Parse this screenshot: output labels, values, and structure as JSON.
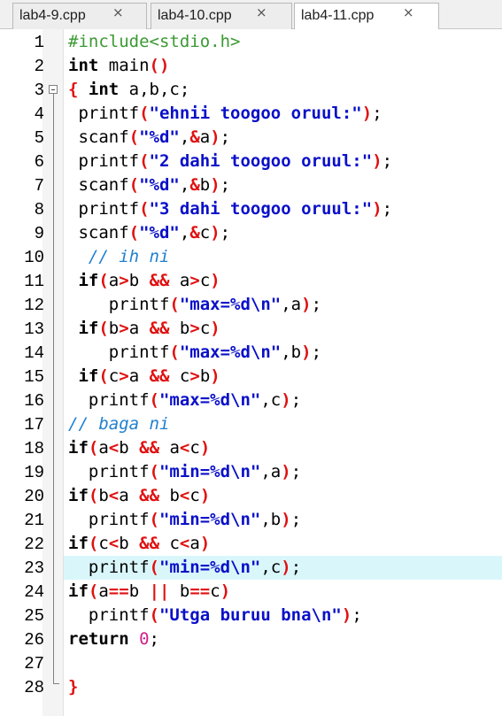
{
  "tabs": [
    {
      "label": "lab4-9.cpp",
      "close": "×",
      "active": false
    },
    {
      "label": "lab4-10.cpp",
      "close": "×",
      "active": false
    },
    {
      "label": "lab4-11.cpp",
      "close": "×",
      "active": true
    }
  ],
  "editor": {
    "highlighted_line": 23,
    "lines": [
      {
        "n": "1",
        "tokens": [
          [
            "pre",
            "#include<stdio.h>"
          ]
        ]
      },
      {
        "n": "2",
        "tokens": [
          [
            "kw",
            "int"
          ],
          [
            "pl",
            " main"
          ],
          [
            "op",
            "()"
          ]
        ]
      },
      {
        "n": "3",
        "tokens": [
          [
            "op",
            "{"
          ],
          [
            "pl",
            " "
          ],
          [
            "kw",
            "int"
          ],
          [
            "pl",
            " a,b,c;"
          ]
        ]
      },
      {
        "n": "4",
        "tokens": [
          [
            "pl",
            " printf"
          ],
          [
            "op",
            "("
          ],
          [
            "str",
            "\"ehnii toogoo oruul:\""
          ],
          [
            "op",
            ")"
          ],
          [
            "pl",
            ";"
          ]
        ]
      },
      {
        "n": "5",
        "tokens": [
          [
            "pl",
            " scanf"
          ],
          [
            "op",
            "("
          ],
          [
            "str",
            "\"%d\""
          ],
          [
            "pl",
            ","
          ],
          [
            "op",
            "&"
          ],
          [
            "pl",
            "a"
          ],
          [
            "op",
            ")"
          ],
          [
            "pl",
            ";"
          ]
        ]
      },
      {
        "n": "6",
        "tokens": [
          [
            "pl",
            " printf"
          ],
          [
            "op",
            "("
          ],
          [
            "str",
            "\"2 dahi toogoo oruul:\""
          ],
          [
            "op",
            ")"
          ],
          [
            "pl",
            ";"
          ]
        ]
      },
      {
        "n": "7",
        "tokens": [
          [
            "pl",
            " scanf"
          ],
          [
            "op",
            "("
          ],
          [
            "str",
            "\"%d\""
          ],
          [
            "pl",
            ","
          ],
          [
            "op",
            "&"
          ],
          [
            "pl",
            "b"
          ],
          [
            "op",
            ")"
          ],
          [
            "pl",
            ";"
          ]
        ]
      },
      {
        "n": "8",
        "tokens": [
          [
            "pl",
            " printf"
          ],
          [
            "op",
            "("
          ],
          [
            "str",
            "\"3 dahi toogoo oruul:\""
          ],
          [
            "op",
            ")"
          ],
          [
            "pl",
            ";"
          ]
        ]
      },
      {
        "n": "9",
        "tokens": [
          [
            "pl",
            " scanf"
          ],
          [
            "op",
            "("
          ],
          [
            "str",
            "\"%d\""
          ],
          [
            "pl",
            ","
          ],
          [
            "op",
            "&"
          ],
          [
            "pl",
            "c"
          ],
          [
            "op",
            ")"
          ],
          [
            "pl",
            ";"
          ]
        ]
      },
      {
        "n": "10",
        "tokens": [
          [
            "pl",
            "  "
          ],
          [
            "cm",
            "// ih ni"
          ]
        ]
      },
      {
        "n": "11",
        "tokens": [
          [
            "pl",
            " "
          ],
          [
            "kw",
            "if"
          ],
          [
            "op",
            "("
          ],
          [
            "pl",
            "a"
          ],
          [
            "op",
            ">"
          ],
          [
            "pl",
            "b "
          ],
          [
            "op",
            "&&"
          ],
          [
            "pl",
            " a"
          ],
          [
            "op",
            ">"
          ],
          [
            "pl",
            "c"
          ],
          [
            "op",
            ")"
          ]
        ]
      },
      {
        "n": "12",
        "tokens": [
          [
            "pl",
            "    printf"
          ],
          [
            "op",
            "("
          ],
          [
            "str",
            "\"max=%d\\n\""
          ],
          [
            "pl",
            ",a"
          ],
          [
            "op",
            ")"
          ],
          [
            "pl",
            ";"
          ]
        ]
      },
      {
        "n": "13",
        "tokens": [
          [
            "pl",
            " "
          ],
          [
            "kw",
            "if"
          ],
          [
            "op",
            "("
          ],
          [
            "pl",
            "b"
          ],
          [
            "op",
            ">"
          ],
          [
            "pl",
            "a "
          ],
          [
            "op",
            "&&"
          ],
          [
            "pl",
            " b"
          ],
          [
            "op",
            ">"
          ],
          [
            "pl",
            "c"
          ],
          [
            "op",
            ")"
          ]
        ]
      },
      {
        "n": "14",
        "tokens": [
          [
            "pl",
            "    printf"
          ],
          [
            "op",
            "("
          ],
          [
            "str",
            "\"max=%d\\n\""
          ],
          [
            "pl",
            ",b"
          ],
          [
            "op",
            ")"
          ],
          [
            "pl",
            ";"
          ]
        ]
      },
      {
        "n": "15",
        "tokens": [
          [
            "pl",
            " "
          ],
          [
            "kw",
            "if"
          ],
          [
            "op",
            "("
          ],
          [
            "pl",
            "c"
          ],
          [
            "op",
            ">"
          ],
          [
            "pl",
            "a "
          ],
          [
            "op",
            "&&"
          ],
          [
            "pl",
            " c"
          ],
          [
            "op",
            ">"
          ],
          [
            "pl",
            "b"
          ],
          [
            "op",
            ")"
          ]
        ]
      },
      {
        "n": "16",
        "tokens": [
          [
            "pl",
            "  printf"
          ],
          [
            "op",
            "("
          ],
          [
            "str",
            "\"max=%d\\n\""
          ],
          [
            "pl",
            ",c"
          ],
          [
            "op",
            ")"
          ],
          [
            "pl",
            ";"
          ]
        ]
      },
      {
        "n": "17",
        "tokens": [
          [
            "cm",
            "// baga ni"
          ]
        ]
      },
      {
        "n": "18",
        "tokens": [
          [
            "kw",
            "if"
          ],
          [
            "op",
            "("
          ],
          [
            "pl",
            "a"
          ],
          [
            "op",
            "<"
          ],
          [
            "pl",
            "b "
          ],
          [
            "op",
            "&&"
          ],
          [
            "pl",
            " a"
          ],
          [
            "op",
            "<"
          ],
          [
            "pl",
            "c"
          ],
          [
            "op",
            ")"
          ]
        ]
      },
      {
        "n": "19",
        "tokens": [
          [
            "pl",
            "  printf"
          ],
          [
            "op",
            "("
          ],
          [
            "str",
            "\"min=%d\\n\""
          ],
          [
            "pl",
            ",a"
          ],
          [
            "op",
            ")"
          ],
          [
            "pl",
            ";"
          ]
        ]
      },
      {
        "n": "20",
        "tokens": [
          [
            "kw",
            "if"
          ],
          [
            "op",
            "("
          ],
          [
            "pl",
            "b"
          ],
          [
            "op",
            "<"
          ],
          [
            "pl",
            "a "
          ],
          [
            "op",
            "&&"
          ],
          [
            "pl",
            " b"
          ],
          [
            "op",
            "<"
          ],
          [
            "pl",
            "c"
          ],
          [
            "op",
            ")"
          ]
        ]
      },
      {
        "n": "21",
        "tokens": [
          [
            "pl",
            "  printf"
          ],
          [
            "op",
            "("
          ],
          [
            "str",
            "\"min=%d\\n\""
          ],
          [
            "pl",
            ",b"
          ],
          [
            "op",
            ")"
          ],
          [
            "pl",
            ";"
          ]
        ]
      },
      {
        "n": "22",
        "tokens": [
          [
            "kw",
            "if"
          ],
          [
            "op",
            "("
          ],
          [
            "pl",
            "c"
          ],
          [
            "op",
            "<"
          ],
          [
            "pl",
            "b "
          ],
          [
            "op",
            "&&"
          ],
          [
            "pl",
            " c"
          ],
          [
            "op",
            "<"
          ],
          [
            "pl",
            "a"
          ],
          [
            "op",
            ")"
          ]
        ]
      },
      {
        "n": "23",
        "tokens": [
          [
            "pl",
            "  printf"
          ],
          [
            "op",
            "("
          ],
          [
            "str",
            "\"min=%d\\n\""
          ],
          [
            "pl",
            ",c"
          ],
          [
            "op",
            ")"
          ],
          [
            "pl",
            ";"
          ]
        ]
      },
      {
        "n": "24",
        "tokens": [
          [
            "kw",
            "if"
          ],
          [
            "op",
            "("
          ],
          [
            "pl",
            "a"
          ],
          [
            "op",
            "=="
          ],
          [
            "pl",
            "b "
          ],
          [
            "op",
            "||"
          ],
          [
            "pl",
            " b"
          ],
          [
            "op",
            "=="
          ],
          [
            "pl",
            "c"
          ],
          [
            "op",
            ")"
          ]
        ]
      },
      {
        "n": "25",
        "tokens": [
          [
            "pl",
            "  printf"
          ],
          [
            "op",
            "("
          ],
          [
            "str",
            "\"Utga buruu bna\\n\""
          ],
          [
            "op",
            ")"
          ],
          [
            "pl",
            ";"
          ]
        ]
      },
      {
        "n": "26",
        "tokens": [
          [
            "kw",
            "return"
          ],
          [
            "pl",
            " "
          ],
          [
            "num",
            "0"
          ],
          [
            "pl",
            ";"
          ]
        ]
      },
      {
        "n": "27",
        "tokens": []
      },
      {
        "n": "28",
        "tokens": [
          [
            "op",
            "}"
          ]
        ]
      }
    ]
  }
}
